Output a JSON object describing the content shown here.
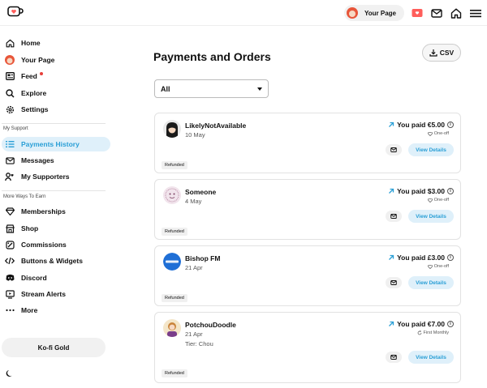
{
  "topbar": {
    "your_page_label": "Your Page"
  },
  "sidebar": {
    "items": [
      {
        "label": "Home",
        "icon": "home-icon"
      },
      {
        "label": "Your Page",
        "icon": "avatar-icon"
      },
      {
        "label": "Feed",
        "icon": "feed-icon"
      },
      {
        "label": "Explore",
        "icon": "search-icon"
      },
      {
        "label": "Settings",
        "icon": "gear-icon"
      }
    ],
    "support_section": "My Support",
    "support_items": [
      {
        "label": "Payments History",
        "icon": "list-icon"
      },
      {
        "label": "Messages",
        "icon": "mail-icon"
      },
      {
        "label": "My Supporters",
        "icon": "supporters-icon"
      }
    ],
    "earn_section": "More Ways To Earn",
    "earn_items": [
      {
        "label": "Memberships",
        "icon": "diamond-icon"
      },
      {
        "label": "Shop",
        "icon": "shop-icon"
      },
      {
        "label": "Commissions",
        "icon": "commissions-icon"
      },
      {
        "label": "Buttons & Widgets",
        "icon": "code-icon"
      },
      {
        "label": "Discord",
        "icon": "discord-icon"
      },
      {
        "label": "Stream Alerts",
        "icon": "stream-icon"
      },
      {
        "label": "More",
        "icon": "more-icon"
      }
    ],
    "gold_label": "Ko-fi Gold"
  },
  "main": {
    "title": "Payments and Orders",
    "csv_label": "CSV",
    "filter_value": "All",
    "view_details_label": "View Details",
    "payments": [
      {
        "name": "LikelyNotAvailable",
        "date": "10 May",
        "tier": "",
        "amount": "You paid €5.00",
        "frequency": "One-off",
        "status": "Refunded"
      },
      {
        "name": "Someone",
        "date": "4 May",
        "tier": "",
        "amount": "You paid $3.00",
        "frequency": "One-off",
        "status": "Refunded"
      },
      {
        "name": "Bishop FM",
        "date": "21 Apr",
        "tier": "",
        "amount": "You paid £3.00",
        "frequency": "One-off",
        "status": "Refunded"
      },
      {
        "name": "PotchouDoodle",
        "date": "21 Apr",
        "tier": "Tier: Chou",
        "amount": "You paid €7.00",
        "frequency": "First Monthly",
        "status": "Refunded"
      }
    ]
  },
  "colors": {
    "accent": "#2a9fd6",
    "active_bg": "#dff0fa"
  }
}
